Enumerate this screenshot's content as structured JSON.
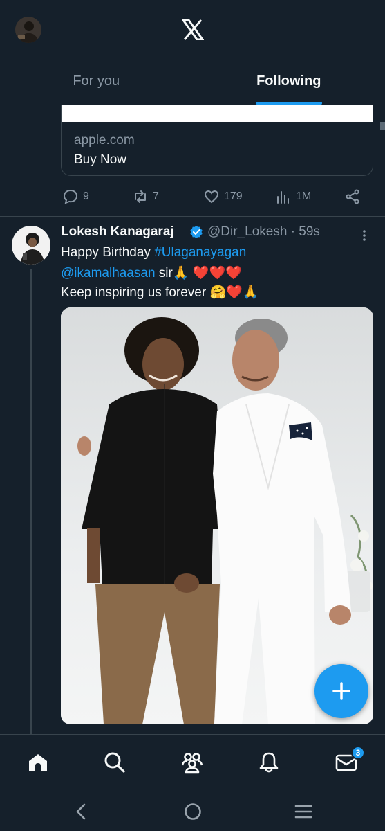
{
  "header": {
    "logo": "x-logo-icon"
  },
  "tabs": [
    {
      "label": "For you",
      "active": false
    },
    {
      "label": "Following",
      "active": true
    }
  ],
  "link_card": {
    "domain": "apple.com",
    "title": "Buy Now"
  },
  "prev_actions": {
    "replies": "9",
    "reposts": "7",
    "likes": "179",
    "views": "1M"
  },
  "post": {
    "author": "Lokesh Kanagaraj",
    "handle": "@Dir_Lokesh",
    "separator": "·",
    "time": "59s",
    "text_line1_a": "Happy Birthday ",
    "text_line1_link": "#Ulaganayagan",
    "text_line2_link": "@ikamalhaasan",
    "text_line2_rest": " sir🙏 ❤️❤️❤️",
    "text_line3": "Keep inspiring us forever 🤗❤️🙏"
  },
  "bottom_nav": {
    "messages_badge": "3"
  },
  "colors": {
    "background": "#15202b",
    "accent": "#1d9bf0",
    "muted": "#8b98a5",
    "border": "#38444d"
  }
}
